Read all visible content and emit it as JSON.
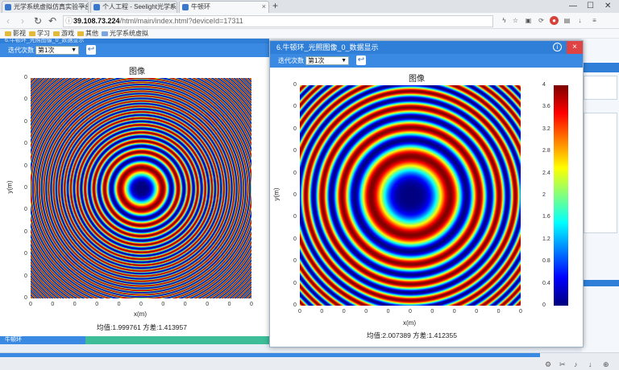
{
  "tabs": [
    {
      "label": "光学系统虚拟仿真实验平台"
    },
    {
      "label": "个人工程 - Seelight光学系统"
    },
    {
      "label": "牛顿环"
    }
  ],
  "address": {
    "host": "39.108.73.224",
    "path": "/html/main/index.html?deviceId=17311"
  },
  "bookmarks": [
    {
      "label": "影视"
    },
    {
      "label": "学习"
    },
    {
      "label": "游戏"
    },
    {
      "label": "其他"
    },
    {
      "label": "光学系统虚拟"
    }
  ],
  "left_panel": {
    "header": "6.牛顿环_光照图像_0_数据显示",
    "iteration_label": "迭代次数",
    "iteration_value": "第1次",
    "plot_title": "图像",
    "xlabel": "x(m)",
    "ylabel": "y(m)",
    "stats": "均值:1.999761  方差:1.413957",
    "bottom_text": "牛顿环"
  },
  "dialog": {
    "title": "6.牛顿环_光照图像_0_数据显示",
    "iteration_label": "迭代次数",
    "iteration_value": "第1次",
    "plot_title": "图像",
    "xlabel": "x(m)",
    "ylabel": "y(m)",
    "stats": "均值:2.007389  方差:1.412355",
    "colorbar_ticks": [
      "4",
      "3.6",
      "3.2",
      "2.8",
      "2.4",
      "2",
      "1.6",
      "1.2",
      "0.8",
      "0.4",
      "0"
    ]
  },
  "tick_zero": "0",
  "chart_data": [
    {
      "type": "heatmap",
      "title": "图像",
      "xlabel": "x(m)",
      "ylabel": "y(m)",
      "description_values": {
        "mean": 1.999761,
        "variance": 1.413957
      },
      "colormap": "jet",
      "value_range": [
        0,
        4
      ]
    },
    {
      "type": "heatmap",
      "title": "图像",
      "xlabel": "x(m)",
      "ylabel": "y(m)",
      "description_values": {
        "mean": 2.007389,
        "variance": 1.412355
      },
      "colormap": "jet",
      "value_range": [
        0,
        4
      ],
      "colorbar_ticks": [
        4,
        3.6,
        3.2,
        2.8,
        2.4,
        2,
        1.6,
        1.2,
        0.8,
        0.4,
        0
      ]
    }
  ],
  "colors": {
    "accent": "#2f7fd8",
    "close": "#e04343",
    "green": "#3dbd98"
  }
}
